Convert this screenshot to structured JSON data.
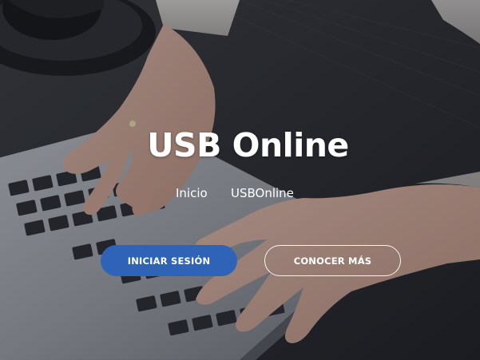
{
  "hero": {
    "title": "USB Online",
    "breadcrumb": {
      "home": "Inicio",
      "current": "USBOnline"
    },
    "buttons": {
      "primary_label": "INICIAR SESIÓN",
      "secondary_label": "CONOCER MÁS"
    }
  },
  "colors": {
    "primary_button": "#2e63b8",
    "text": "#ffffff"
  }
}
